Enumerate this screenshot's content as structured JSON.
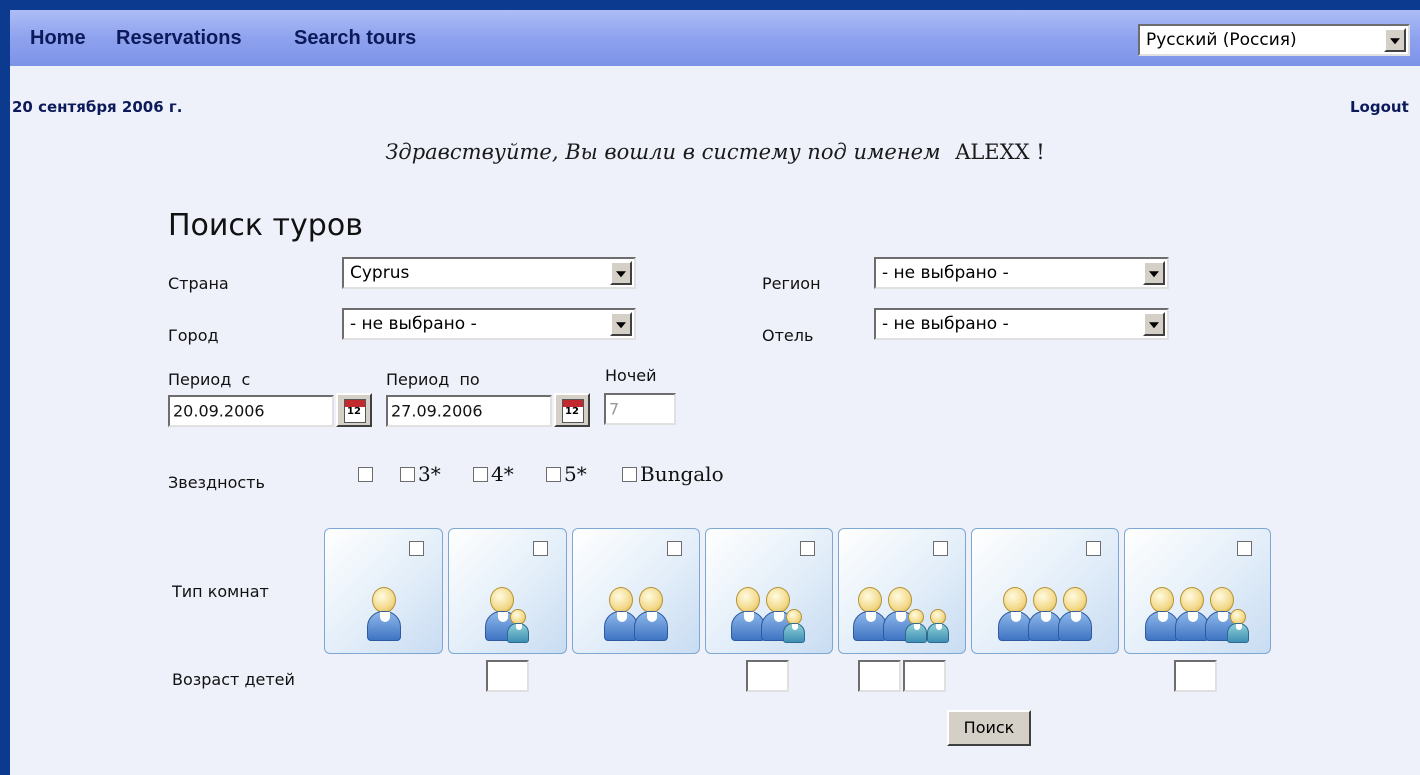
{
  "nav": {
    "items": [
      "Home",
      "Reservations",
      "Search tours"
    ],
    "language": "Русский (Россия)"
  },
  "header": {
    "date": "20 сентября 2006 г.",
    "logout": "Logout"
  },
  "welcome": {
    "message": "Здравствуйте, Вы вошли в систему под именем",
    "username": "ALEXX",
    "suffix": "!"
  },
  "form": {
    "title": "Поиск туров",
    "country_label": "Страна",
    "country_value": "Cyprus",
    "region_label": "Регион",
    "region_value": "- не выбрано -",
    "city_label": "Город",
    "city_value": "- не выбрано -",
    "hotel_label": "Отель",
    "hotel_value": "- не выбрано -",
    "period_from_label": "Период  с",
    "period_from_value": "20.09.2006",
    "period_to_label": "Период  по",
    "period_to_value": "27.09.2006",
    "nights_label": "Ночей",
    "nights_value": "7",
    "stars_label": "Звездность",
    "stars_options": [
      "",
      "3*",
      "4*",
      "5*",
      "Bungalo"
    ],
    "room_type_label": "Тип комнат",
    "room_types": [
      {
        "adults": 1,
        "children": 0
      },
      {
        "adults": 1,
        "children": 1
      },
      {
        "adults": 2,
        "children": 0
      },
      {
        "adults": 2,
        "children": 1
      },
      {
        "adults": 2,
        "children": 2
      },
      {
        "adults": 3,
        "children": 0
      },
      {
        "adults": 3,
        "children": 1
      }
    ],
    "child_age_label": "Возраст детей",
    "search_button": "Поиск"
  },
  "colors": {
    "navbar": "#8ea2ee",
    "nav_text": "#0d1a5a",
    "page_bg": "#eef1fa",
    "outer_bg": "#0b3a8f"
  }
}
